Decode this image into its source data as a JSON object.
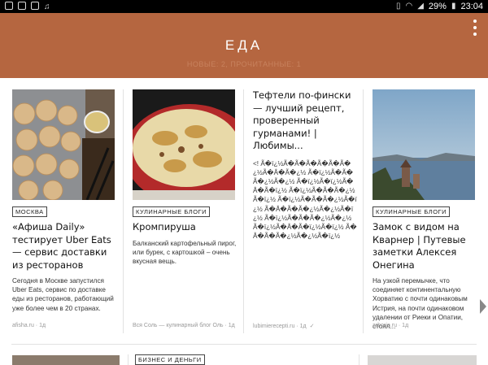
{
  "status": {
    "battery": "29%",
    "time": "23:04"
  },
  "appbar": {
    "title": "ЕДА",
    "subtitle": "НОВЫЕ: 2, ПРОЧИТАННЫЕ: 1"
  },
  "cards": [
    {
      "tag": "МОСКВА",
      "headline": "«Афиша Daily» тестирует Uber Eats — сервис доставки из ресторанов",
      "desc": "Сегодня в Москве запустился Uber Eats, сервис по доставке еды из ресторанов, работающий уже более чем в 20 странах.",
      "source": "afisha.ru · 1д"
    },
    {
      "tag": "КУЛИНАРНЫЕ БЛОГИ",
      "headline": "Кромпируша",
      "desc": "Балканский картофельный пирог, или бурек, с картошкой – очень вкусная вещь.",
      "source": "Вся Соль — кулинарный блог Оль · 1д"
    },
    {
      "tag": "",
      "headline": "Тефтели по-фински — лучший рецепт, проверенный гурманами! | Любимы...",
      "desc": "<! Ã�ï¿½Ã�Ã�Ã�Ã�Ã�Ã�¿½Ã�Â�Ã�¿½ Ã�ï¿½Ã�Ã�Ã�¿½Ã�¿½ Ã�ï¿½Ã�ï¿½Ã�Â�Ã�ï¿½ Ã�ï¿½Ã�Ã�Ã�¿½Ã�ï¿½ Ã�ï¿½Ã�Ã�Ã�¿½Ã�ï¿½ Ã�Â�Ã�Ã�¿½Ã�¿½Ã�ï¿½ Ã�ï¿½Ã�Ã�Ã�¿½Ã�¿½ Ã�ï¿½Ã�Â�Ã�ï¿½Ã�ï¿½ Ã�Â�Ã�Ã�¿½Ã�¿½Ã�ï¿½",
      "source": "lubimiereceptі.ru · 1д",
      "check": "✓"
    },
    {
      "tag": "КУЛИНАРНЫЕ БЛОГИ",
      "headline": "Замок с видом на Кварнер | Путевые заметки Алексея Онегина",
      "desc": "На узкой перемычке, что соединяет континентальную Хорватию с почти одинаковым Истрия, на почти одинаковом удалении от Риеки и Опатии, стоял...",
      "source": "arborio.ru · 1д"
    }
  ],
  "bottom": {
    "tag": "БИЗНЕС И ДЕНЬГИ"
  }
}
